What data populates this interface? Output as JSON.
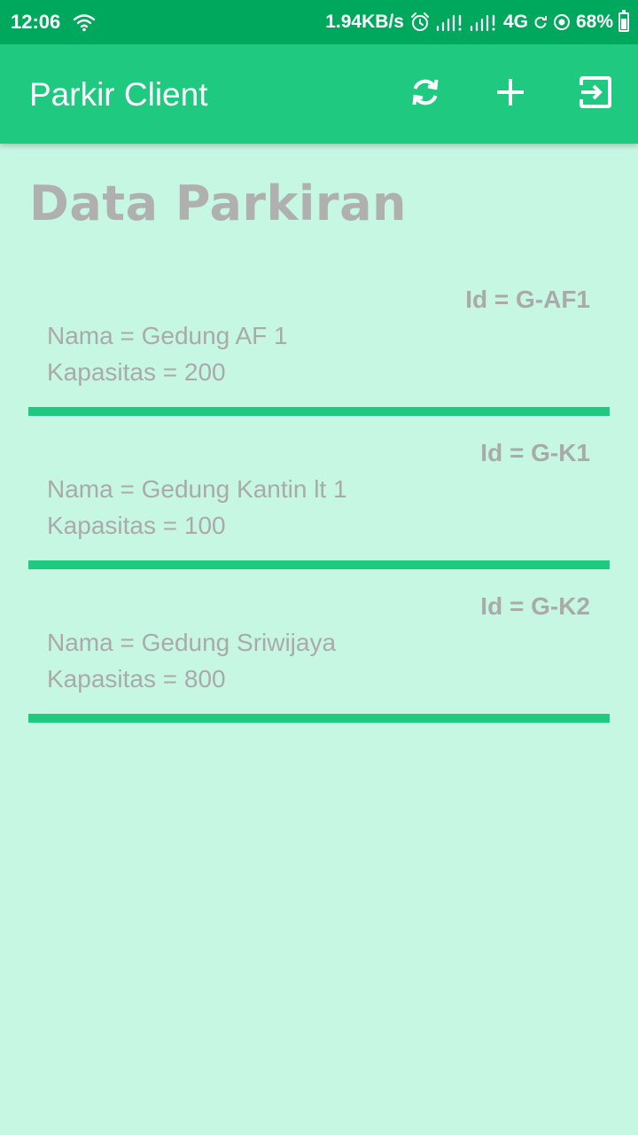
{
  "status_bar": {
    "time": "12:06",
    "net_speed": "1.94KB/s",
    "network_type": "4G",
    "battery": "68%",
    "battery_level": 0.68,
    "icons": [
      "wifi-icon",
      "alarm-icon",
      "signal-icon",
      "signal-icon",
      "sync-icon",
      "location-icon",
      "battery-icon"
    ]
  },
  "app_bar": {
    "title": "Parkir Client",
    "actions": [
      "refresh-icon",
      "add-icon",
      "logout-icon"
    ],
    "color": "#20c980"
  },
  "page": {
    "heading": "Data Parkiran",
    "background": "#c6f7e2"
  },
  "items": [
    {
      "id": "Id = G-AF1",
      "nama": "Nama = Gedung AF 1",
      "kapasitas": "Kapasitas = 200"
    },
    {
      "id": "Id = G-K1",
      "nama": "Nama = Gedung Kantin lt 1",
      "kapasitas": "Kapasitas = 100"
    },
    {
      "id": "Id = G-K2",
      "nama": "Nama = Gedung Sriwijaya",
      "kapasitas": "Kapasitas = 800"
    }
  ]
}
